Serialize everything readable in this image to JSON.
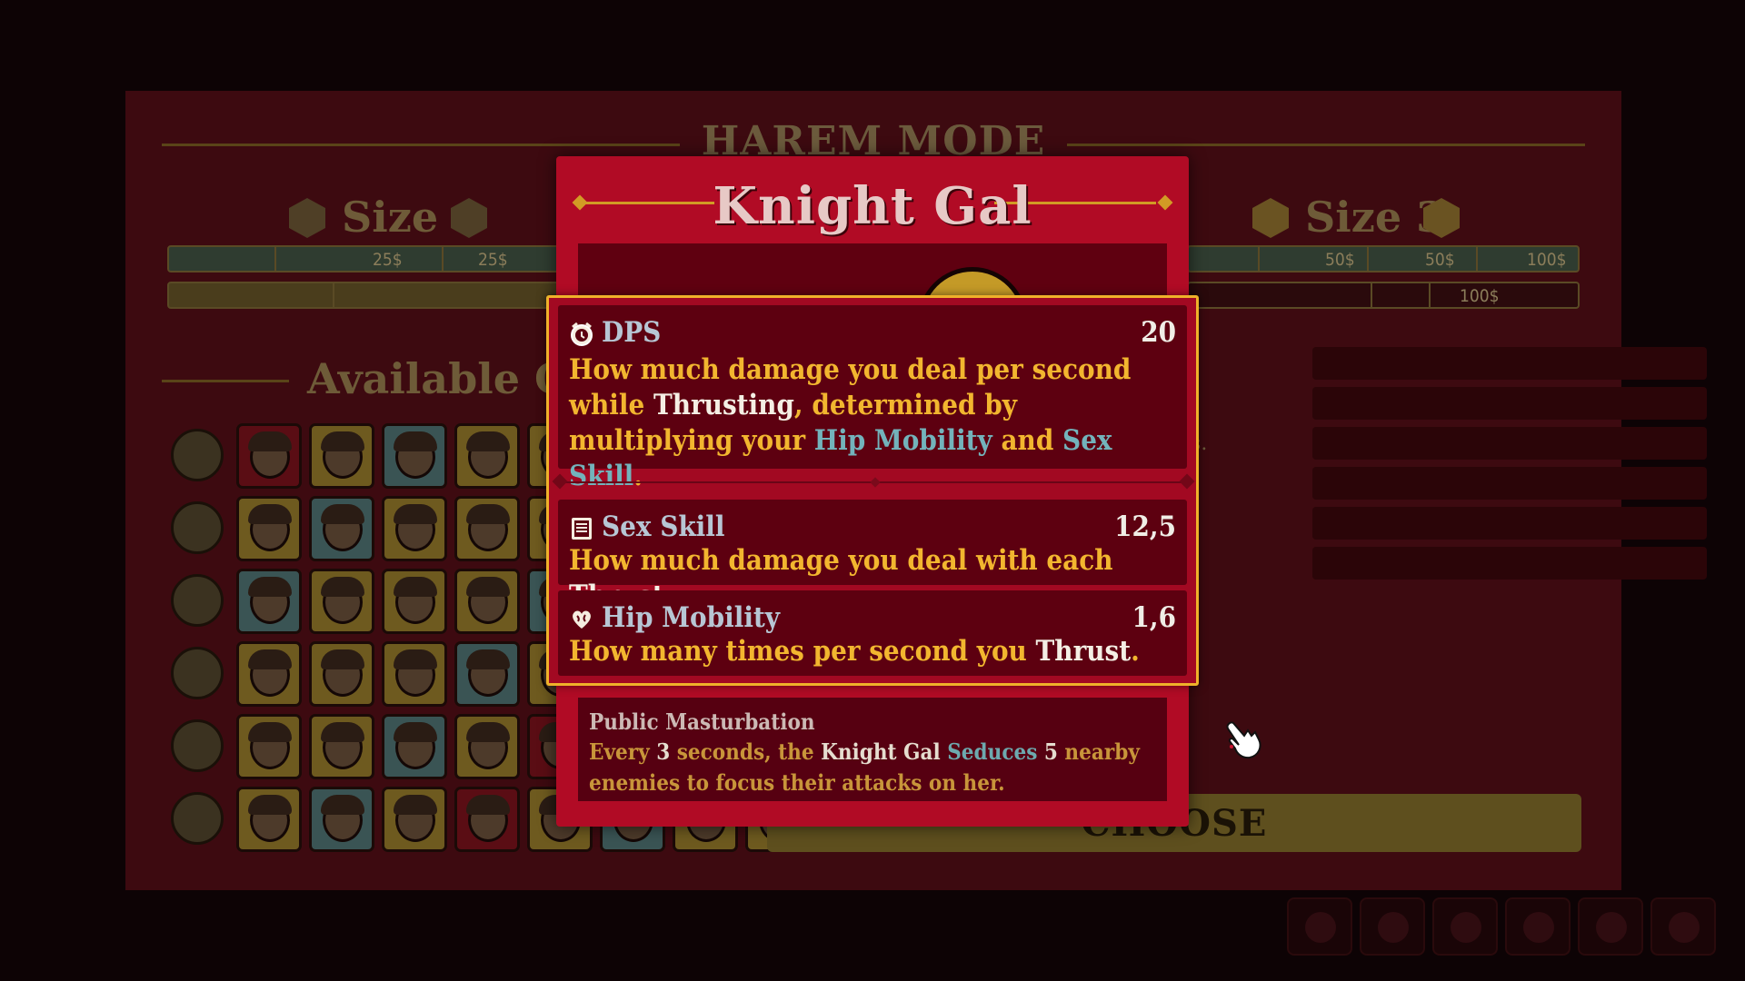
{
  "background": {
    "title": "HAREM MODE",
    "size_left": "Size 1",
    "size_right": "Size 3",
    "available_title": "Available Gal",
    "left_bar_prices": [
      "25$",
      "25$"
    ],
    "right_bar_prices": [
      "50$",
      "50$",
      "100$"
    ],
    "right_bar2_prices": [
      "100$"
    ],
    "details_fragment": "ls.",
    "choose_label": "CHOOSE"
  },
  "card": {
    "title": "Knight Gal",
    "ability": {
      "name": "Public Masturbation",
      "desc_1": "Every ",
      "count": "3",
      "desc_2": " seconds, the ",
      "gal": "Knight Gal",
      "desc_3": " ",
      "effect": "Seduces",
      "desc_4": " ",
      "targets": "5",
      "desc_5": " nearby enemies to focus their attacks on her."
    }
  },
  "tooltip": {
    "dps": {
      "icon": "alarm-clock-icon",
      "name": "DPS",
      "value": "20",
      "d1": "How much damage you deal per second while ",
      "d2": "Thrusting",
      "d3": ", determined by multiplying your ",
      "d4": "Hip Mobility",
      "d5": " and ",
      "d6": "Sex Skill",
      "d7": "."
    },
    "sex_skill": {
      "icon": "book-icon",
      "name": "Sex Skill",
      "value": "12,5",
      "d1": "How much damage you deal with each ",
      "d2": "Thrust",
      "d3": "."
    },
    "hip_mobility": {
      "icon": "heart-brain-icon",
      "name": "Hip Mobility",
      "value": "1,6",
      "d1": "How many times per second you ",
      "d2": "Thrust",
      "d3": "."
    }
  },
  "colors": {
    "card_red": "#b10b25",
    "tooltip_border": "#efb12a",
    "highlight_blue": "#73b3bb",
    "text_gold": "#f2b62f"
  }
}
